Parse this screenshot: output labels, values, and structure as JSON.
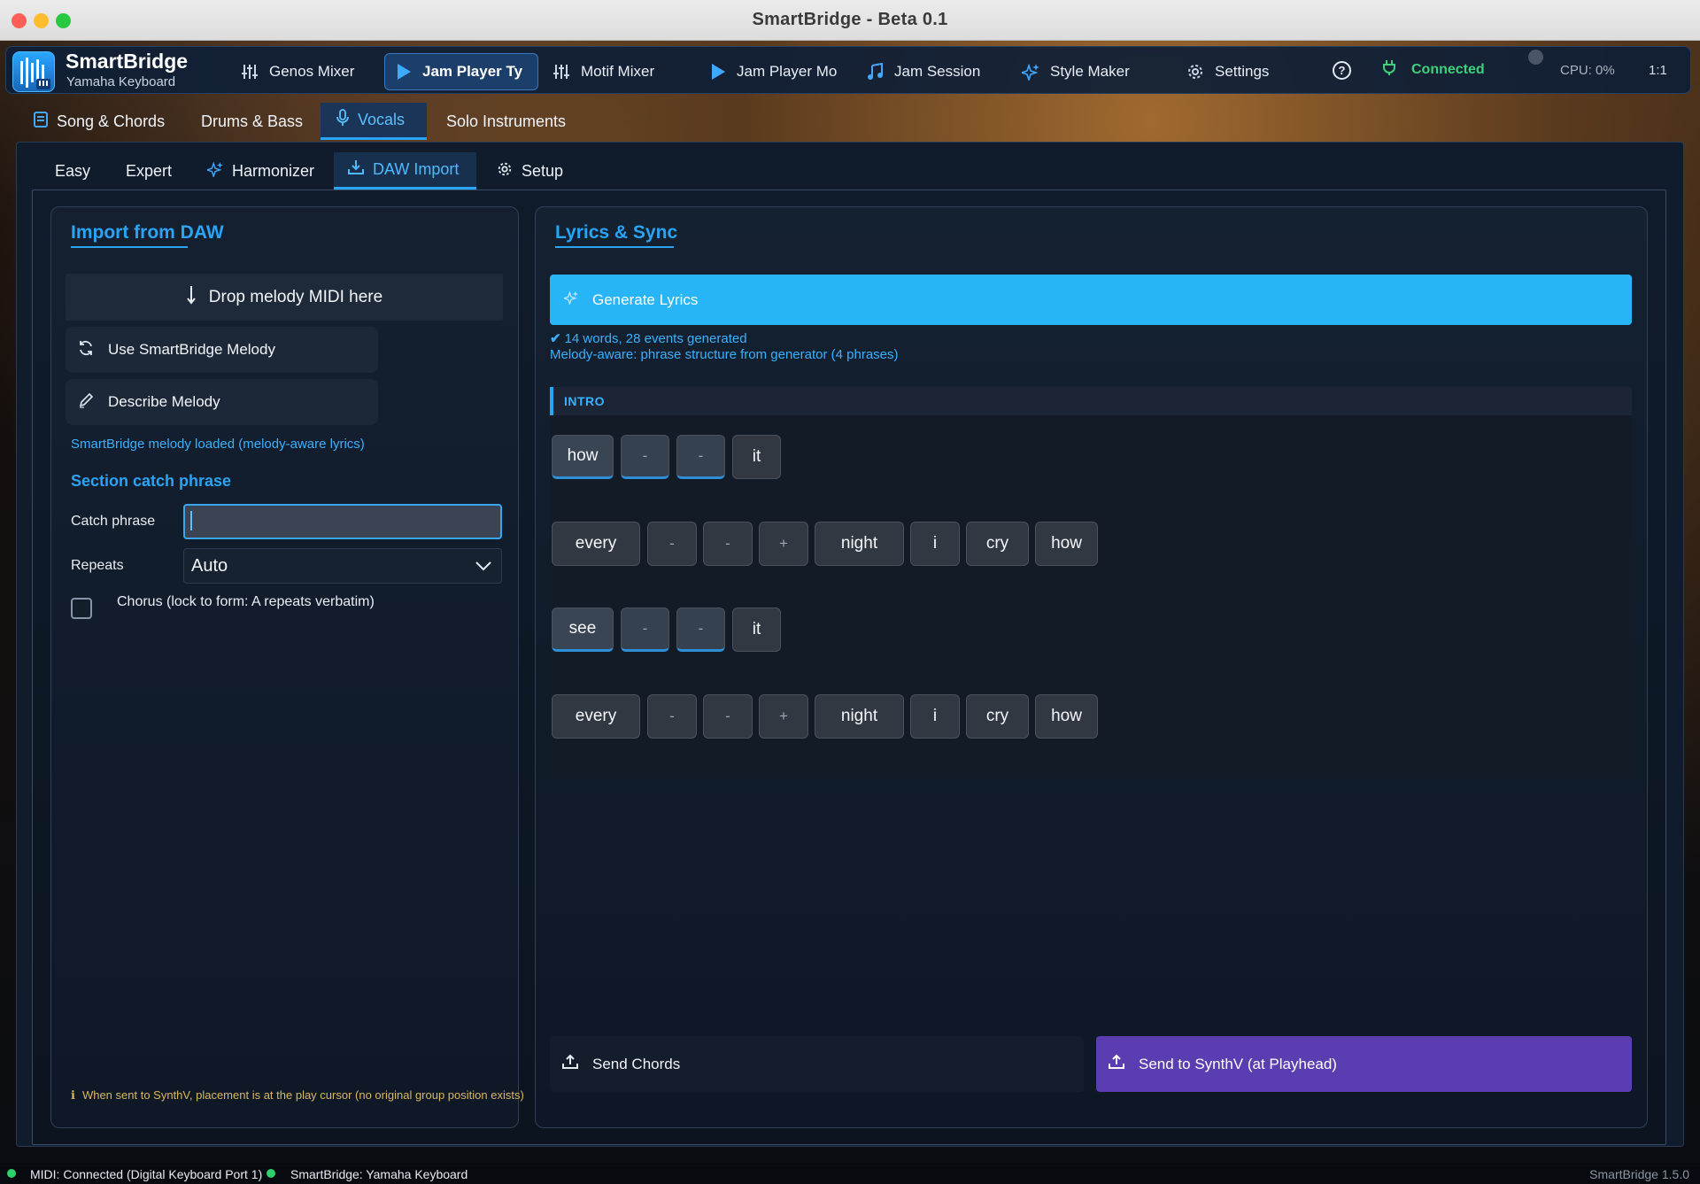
{
  "window": {
    "title": "SmartBridge  -  Beta 0.1"
  },
  "brand": {
    "name": "SmartBridge",
    "subtitle": "Yamaha Keyboard"
  },
  "nav": {
    "items": [
      {
        "label": "Genos Mixer",
        "icon": "sliders-icon"
      },
      {
        "label": "Jam Player Ty",
        "icon": "play-icon",
        "active": true
      },
      {
        "label": "Motif Mixer",
        "icon": "sliders-icon"
      },
      {
        "label": "Jam Player Mo",
        "icon": "play-icon"
      },
      {
        "label": "Jam Session",
        "icon": "music-note-icon"
      },
      {
        "label": "Style Maker",
        "icon": "sparkle-icon"
      },
      {
        "label": "Settings",
        "icon": "gear-icon"
      }
    ],
    "help": "?",
    "connection": "Connected",
    "cpu": "CPU: 0%",
    "ratio": "1:1"
  },
  "subtabs": [
    {
      "label": "Song & Chords",
      "icon": "song-icon"
    },
    {
      "label": "Drums & Bass"
    },
    {
      "label": "Vocals",
      "icon": "mic-icon",
      "active": true
    },
    {
      "label": "Solo Instruments"
    }
  ],
  "vocal_tabs": [
    {
      "label": "Easy"
    },
    {
      "label": "Expert"
    },
    {
      "label": "Harmonizer",
      "icon": "sparkle-icon"
    },
    {
      "label": "DAW Import",
      "icon": "download-icon",
      "active": true
    },
    {
      "label": "Setup",
      "icon": "gear-icon"
    }
  ],
  "import_panel": {
    "title": "Import from DAW",
    "drop_label": "Drop melody MIDI here",
    "use_melody_label": "Use SmartBridge Melody",
    "describe_label": "Describe Melody",
    "loaded_status": "SmartBridge melody loaded (melody-aware lyrics)",
    "section_heading": "Section catch phrase",
    "catch_label": "Catch phrase",
    "catch_value": "",
    "repeats_label": "Repeats",
    "repeats_value": "Auto",
    "chorus_label": "Chorus (lock to form: A repeats verbatim)",
    "chorus_checked": false,
    "footnote": "When sent to SynthV, placement is at the play cursor (no original group position exists)"
  },
  "lyrics_panel": {
    "title": "Lyrics & Sync",
    "generate_label": "Generate Lyrics",
    "status_words": "14 words, 28 events generated",
    "status_phrase": "Melody-aware: phrase structure from generator (4 phrases)",
    "section_label": "INTRO",
    "rows": [
      [
        "how",
        "-",
        "-",
        "it"
      ],
      [
        "every",
        "-",
        "-",
        "+",
        "night",
        "i",
        "cry",
        "how"
      ],
      [
        "see",
        "-",
        "-",
        "it"
      ],
      [
        "every",
        "-",
        "-",
        "+",
        "night",
        "i",
        "cry",
        "how"
      ]
    ],
    "send_chords_label": "Send Chords",
    "send_synth_label": "Send to SynthV (at Playhead)"
  },
  "statusbar": {
    "midi": "MIDI: Connected (Digital Keyboard Port 1)",
    "bridge": "SmartBridge: Yamaha Keyboard",
    "version": "SmartBridge 1.5.0"
  },
  "colors": {
    "accent": "#2aa4f4",
    "connected": "#3ed07a",
    "synth_button": "#5a3db0",
    "generate_button": "#27b5f8"
  }
}
